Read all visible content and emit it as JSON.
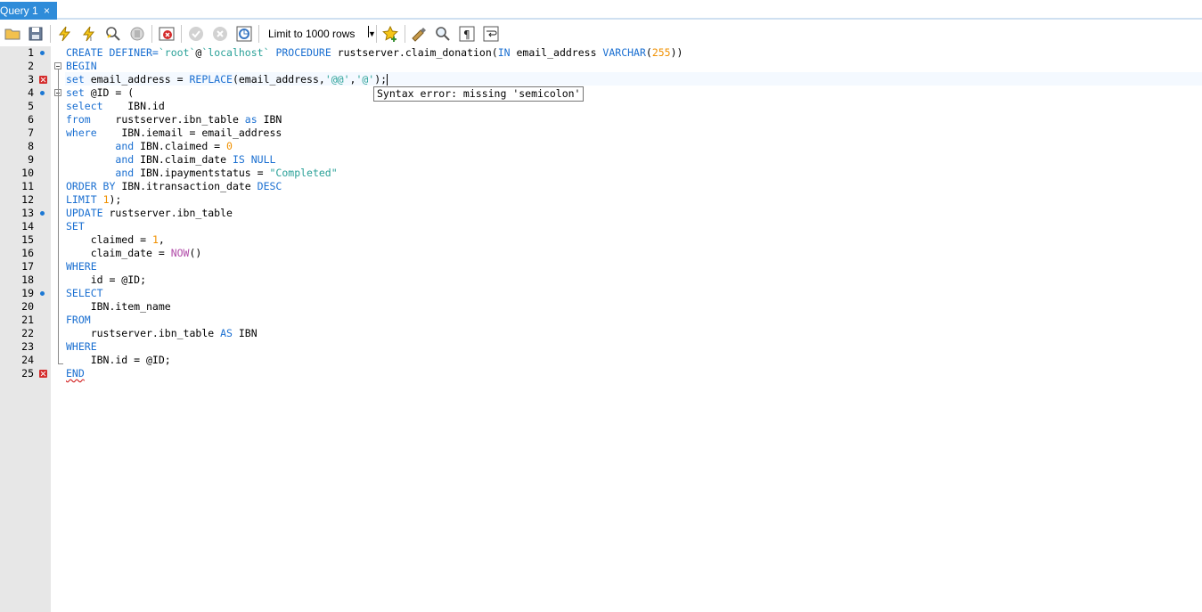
{
  "tabs": [
    {
      "label": "Query 1",
      "close": "×"
    }
  ],
  "toolbar": {
    "limit_value": "Limit to 1000 rows",
    "icons": [
      "open-folder-icon",
      "save-icon",
      "execute-icon",
      "execute-current-icon",
      "explain-icon",
      "stop-icon",
      "toggle-error-icon",
      "commit-icon",
      "rollback-icon",
      "autocommit-icon",
      "add-snippet-icon",
      "beautify-icon",
      "find-icon",
      "invisible-chars-icon",
      "word-wrap-icon"
    ]
  },
  "editor": {
    "line_numbers": [
      "1",
      "2",
      "3",
      "4",
      "5",
      "6",
      "7",
      "8",
      "9",
      "10",
      "11",
      "12",
      "13",
      "14",
      "15",
      "16",
      "17",
      "18",
      "19",
      "20",
      "21",
      "22",
      "23",
      "24",
      "25"
    ],
    "lines": [
      {
        "segments": [
          {
            "t": "CREATE DEFINER=",
            "c": "kw"
          },
          {
            "t": "`root`",
            "c": "str"
          },
          {
            "t": "@",
            "c": ""
          },
          {
            "t": "`localhost`",
            "c": "str"
          },
          {
            "t": " PROCEDURE ",
            "c": "kw"
          },
          {
            "t": "rustserver.claim_donation(",
            "c": ""
          },
          {
            "t": "IN",
            "c": "kw"
          },
          {
            "t": " email_address ",
            "c": ""
          },
          {
            "t": "VARCHAR",
            "c": "kw"
          },
          {
            "t": "(",
            "c": ""
          },
          {
            "t": "255",
            "c": "num"
          },
          {
            "t": "))",
            "c": ""
          }
        ]
      },
      {
        "segments": [
          {
            "t": "BEGIN",
            "c": "kw"
          }
        ]
      },
      {
        "segments": [
          {
            "t": "set",
            "c": "kw"
          },
          {
            "t": " email_address = ",
            "c": ""
          },
          {
            "t": "REPLACE",
            "c": "fn"
          },
          {
            "t": "(email_address,",
            "c": ""
          },
          {
            "t": "'@@'",
            "c": "str"
          },
          {
            "t": ",",
            "c": ""
          },
          {
            "t": "'@'",
            "c": "str"
          },
          {
            "t": ");",
            "c": ""
          }
        ]
      },
      {
        "segments": [
          {
            "t": "set",
            "c": "kw"
          },
          {
            "t": " @ID = (",
            "c": ""
          }
        ]
      },
      {
        "segments": [
          {
            "t": "select",
            "c": "kw"
          },
          {
            "t": "    IBN.id",
            "c": ""
          }
        ]
      },
      {
        "segments": [
          {
            "t": "from",
            "c": "kw"
          },
          {
            "t": "    rustserver.ibn_table ",
            "c": ""
          },
          {
            "t": "as",
            "c": "kw"
          },
          {
            "t": " IBN",
            "c": ""
          }
        ]
      },
      {
        "segments": [
          {
            "t": "where",
            "c": "kw"
          },
          {
            "t": "    IBN.iemail = email_address",
            "c": ""
          }
        ]
      },
      {
        "segments": [
          {
            "t": "        ",
            "c": ""
          },
          {
            "t": "and",
            "c": "kw"
          },
          {
            "t": " IBN.claimed = ",
            "c": ""
          },
          {
            "t": "0",
            "c": "num"
          }
        ]
      },
      {
        "segments": [
          {
            "t": "        ",
            "c": ""
          },
          {
            "t": "and",
            "c": "kw"
          },
          {
            "t": " IBN.claim_date ",
            "c": ""
          },
          {
            "t": "IS NULL",
            "c": "kw"
          }
        ]
      },
      {
        "segments": [
          {
            "t": "        ",
            "c": ""
          },
          {
            "t": "and",
            "c": "kw"
          },
          {
            "t": " IBN.ipaymentstatus = ",
            "c": ""
          },
          {
            "t": "\"Completed\"",
            "c": "str"
          }
        ]
      },
      {
        "segments": [
          {
            "t": "ORDER BY",
            "c": "kw"
          },
          {
            "t": " IBN.itransaction_date ",
            "c": ""
          },
          {
            "t": "DESC",
            "c": "kw"
          }
        ]
      },
      {
        "segments": [
          {
            "t": "LIMIT",
            "c": "kw"
          },
          {
            "t": " ",
            "c": ""
          },
          {
            "t": "1",
            "c": "num"
          },
          {
            "t": ");",
            "c": ""
          }
        ]
      },
      {
        "segments": [
          {
            "t": "UPDATE",
            "c": "kw"
          },
          {
            "t": " rustserver.ibn_table",
            "c": ""
          }
        ]
      },
      {
        "segments": [
          {
            "t": "SET",
            "c": "kw"
          }
        ]
      },
      {
        "segments": [
          {
            "t": "    claimed = ",
            "c": ""
          },
          {
            "t": "1",
            "c": "num"
          },
          {
            "t": ",",
            "c": ""
          }
        ]
      },
      {
        "segments": [
          {
            "t": "    claim_date = ",
            "c": ""
          },
          {
            "t": "NOW",
            "c": "now"
          },
          {
            "t": "()",
            "c": ""
          }
        ]
      },
      {
        "segments": [
          {
            "t": "WHERE",
            "c": "kw"
          }
        ]
      },
      {
        "segments": [
          {
            "t": "    id = @ID;",
            "c": ""
          }
        ]
      },
      {
        "segments": [
          {
            "t": "SELECT",
            "c": "kw"
          }
        ]
      },
      {
        "segments": [
          {
            "t": "    IBN.item_name",
            "c": ""
          }
        ]
      },
      {
        "segments": [
          {
            "t": "FROM",
            "c": "kw"
          }
        ]
      },
      {
        "segments": [
          {
            "t": "    rustserver.ibn_table ",
            "c": ""
          },
          {
            "t": "AS",
            "c": "kw"
          },
          {
            "t": " IBN",
            "c": ""
          }
        ]
      },
      {
        "segments": [
          {
            "t": "WHERE",
            "c": "kw"
          }
        ]
      },
      {
        "segments": [
          {
            "t": "    IBN.id = @ID;",
            "c": ""
          }
        ]
      },
      {
        "segments": [
          {
            "t": "END",
            "c": "err-end"
          }
        ]
      }
    ],
    "statement_dots": [
      1,
      4,
      13,
      19
    ],
    "error_markers": [
      3,
      25
    ],
    "tooltip": "Syntax error: missing 'semicolon'"
  }
}
